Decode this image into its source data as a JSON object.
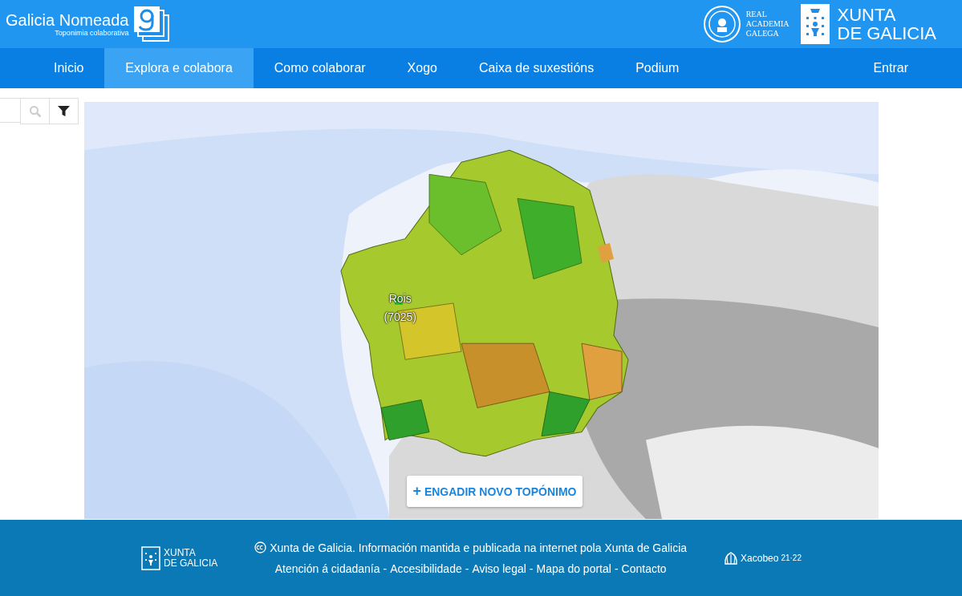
{
  "header": {
    "site_title": "Galicia Nomeada",
    "site_subtitle": "Toponimia colaborativa",
    "academy_logo_text": [
      "REAL",
      "ACADEMIA",
      "GALEGA"
    ],
    "xunta_logo_text": [
      "XUNTA",
      "DE GALICIA"
    ]
  },
  "nav": {
    "items": [
      {
        "label": "Inicio",
        "selected": false
      },
      {
        "label": "Explora e colabora",
        "selected": true
      },
      {
        "label": "Como colaborar",
        "selected": false
      },
      {
        "label": "Xogo",
        "selected": false
      },
      {
        "label": "Caixa de suxestións",
        "selected": false
      },
      {
        "label": "Podium",
        "selected": false
      }
    ],
    "login": "Entrar"
  },
  "map": {
    "marker": {
      "name": "Rois",
      "count": "(7025)"
    },
    "add_button": {
      "icon": "+",
      "label": "ENGADIR NOVO TOPÓNIMO"
    }
  },
  "footer": {
    "logo_text": [
      "XUNTA",
      "DE GALICIA"
    ],
    "copyright": "Xunta de Galicia. Información mantida e publicada na internet pola Xunta de Galicia",
    "links": [
      "Atención á cidadanía",
      "Accesibilidade",
      "Aviso legal",
      "Mapa do portal",
      "Contacto"
    ],
    "separator": "-",
    "xacobeo": "Xacobeo",
    "xacobeo_years": "21·22"
  }
}
